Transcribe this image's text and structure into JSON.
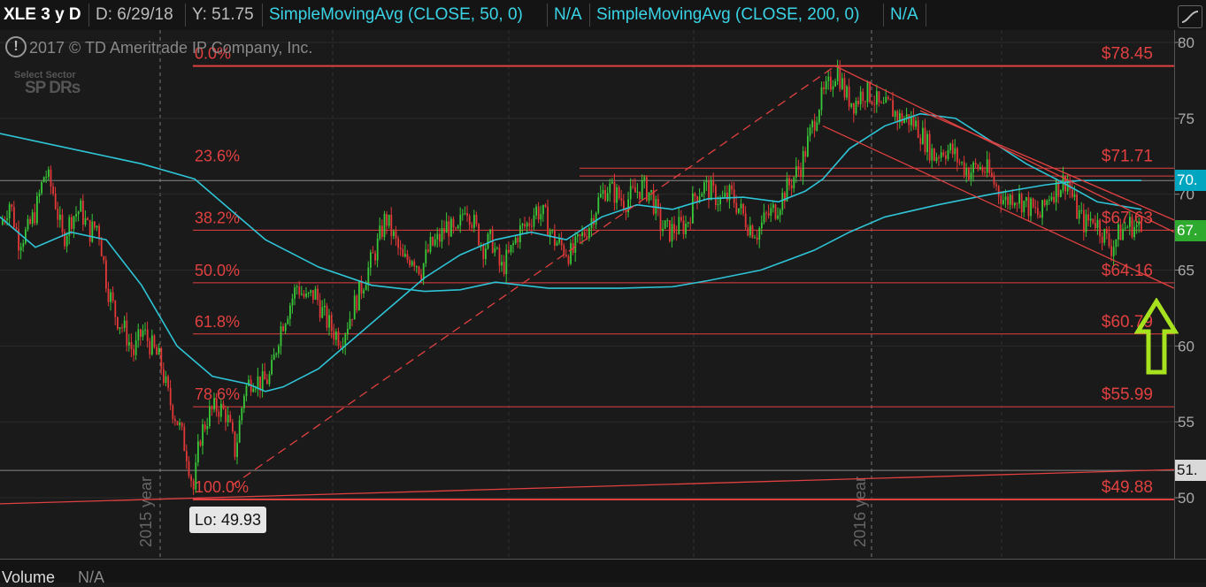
{
  "header": {
    "symbol": "XLE 3 y D",
    "date": "D: 6/29/18",
    "y_readout": "Y: 51.75",
    "sma50": "SimpleMovingAvg (CLOSE, 50, 0)",
    "sma50_value": "N/A",
    "sma200": "SimpleMovingAvg (CLOSE, 200, 0)",
    "sma200_value": "N/A"
  },
  "watermark": {
    "copyright": "2017 © TD Ameritrade IP Company, Inc.",
    "info_icon": "!",
    "logo_line1": "Select Sector",
    "logo_line2": "SP DRs"
  },
  "footer": {
    "volume_label": "Volume",
    "volume_value": "N/A"
  },
  "lo_label": "Lo: 49.93",
  "price_tags": [
    {
      "text": "70.",
      "value": 70.9,
      "bg": "#00a6c0",
      "fg": "#ffffff"
    },
    {
      "text": "67.",
      "value": 67.6,
      "bg": "#2eaa2e",
      "fg": "#ffffff"
    },
    {
      "text": "51.",
      "value": 51.8,
      "bg": "#d9d9d9",
      "fg": "#111111"
    }
  ],
  "colors": {
    "up": "#38c838",
    "down": "#e23838",
    "fib": "#e04040",
    "sma50": "#2ec4d6",
    "sma200": "#2ec4d6",
    "arrow": "#a6e21e"
  },
  "chart_data": {
    "type": "candlestick",
    "ylim": [
      45,
      81
    ],
    "yticks": [
      "80",
      "75",
      "70",
      "65",
      "60",
      "55",
      "50"
    ],
    "x_labels": [
      "2015 year",
      "2016 year"
    ],
    "fib_levels": [
      {
        "pct": "0.0%",
        "price": "$78.45",
        "value": 78.45
      },
      {
        "pct": "23.6%",
        "price": "$71.71",
        "value": 71.71
      },
      {
        "pct": "38.2%",
        "price": "$67.63",
        "value": 67.63
      },
      {
        "pct": "50.0%",
        "price": "$64.16",
        "value": 64.16
      },
      {
        "pct": "61.8%",
        "price": "$60.79",
        "value": 60.79
      },
      {
        "pct": "78.6%",
        "price": "$55.99",
        "value": 55.99
      },
      {
        "pct": "100.0%",
        "price": "$49.88",
        "value": 49.88
      }
    ],
    "gray_levels": [
      70.9,
      51.8
    ],
    "price_path": [
      [
        0,
        68
      ],
      [
        10,
        69.5
      ],
      [
        20,
        67
      ],
      [
        30,
        67.5
      ],
      [
        40,
        69
      ],
      [
        50,
        71.5
      ],
      [
        60,
        70
      ],
      [
        70,
        67
      ],
      [
        80,
        68.5
      ],
      [
        90,
        69
      ],
      [
        100,
        67.5
      ],
      [
        110,
        68
      ],
      [
        120,
        64
      ],
      [
        130,
        62
      ],
      [
        140,
        61
      ],
      [
        150,
        59.5
      ],
      [
        160,
        61
      ],
      [
        170,
        60
      ],
      [
        180,
        59
      ],
      [
        190,
        56.5
      ],
      [
        200,
        55
      ],
      [
        210,
        53
      ],
      [
        218,
        50.5
      ],
      [
        225,
        54
      ],
      [
        235,
        55.5
      ],
      [
        245,
        56
      ],
      [
        255,
        55.5
      ],
      [
        265,
        53
      ],
      [
        275,
        57
      ],
      [
        285,
        58
      ],
      [
        295,
        57.5
      ],
      [
        305,
        58
      ],
      [
        315,
        61
      ],
      [
        325,
        62.5
      ],
      [
        335,
        64
      ],
      [
        345,
        63
      ],
      [
        355,
        63.5
      ],
      [
        365,
        62
      ],
      [
        375,
        61
      ],
      [
        385,
        60.5
      ],
      [
        395,
        62
      ],
      [
        405,
        63.5
      ],
      [
        415,
        65
      ],
      [
        425,
        66.5
      ],
      [
        435,
        68.5
      ],
      [
        445,
        67
      ],
      [
        455,
        65.5
      ],
      [
        465,
        66
      ],
      [
        475,
        65
      ],
      [
        485,
        66.5
      ],
      [
        495,
        67
      ],
      [
        505,
        68
      ],
      [
        515,
        67
      ],
      [
        525,
        69.5
      ],
      [
        535,
        68
      ],
      [
        545,
        66.5
      ],
      [
        555,
        67
      ],
      [
        565,
        65
      ],
      [
        575,
        66
      ],
      [
        585,
        67.5
      ],
      [
        595,
        68
      ],
      [
        605,
        69
      ],
      [
        615,
        68.5
      ],
      [
        625,
        67
      ],
      [
        635,
        66.5
      ],
      [
        645,
        66
      ],
      [
        655,
        67
      ],
      [
        665,
        68
      ],
      [
        675,
        69.5
      ],
      [
        685,
        70.5
      ],
      [
        695,
        70
      ],
      [
        705,
        69.5
      ],
      [
        715,
        70
      ],
      [
        725,
        70.5
      ],
      [
        735,
        70
      ],
      [
        745,
        68
      ],
      [
        755,
        67.5
      ],
      [
        765,
        67.8
      ],
      [
        775,
        68
      ],
      [
        785,
        70
      ],
      [
        795,
        70.5
      ],
      [
        805,
        70
      ],
      [
        815,
        69.5
      ],
      [
        825,
        70
      ],
      [
        835,
        69
      ],
      [
        845,
        68
      ],
      [
        855,
        67.5
      ],
      [
        865,
        68.5
      ],
      [
        875,
        69
      ],
      [
        885,
        70
      ],
      [
        895,
        71
      ],
      [
        905,
        72
      ],
      [
        915,
        74
      ],
      [
        925,
        76
      ],
      [
        935,
        77
      ],
      [
        945,
        78.3
      ],
      [
        955,
        76.5
      ],
      [
        965,
        76
      ],
      [
        975,
        76.8
      ],
      [
        985,
        76.5
      ],
      [
        995,
        75.5
      ],
      [
        1005,
        75.8
      ],
      [
        1015,
        75
      ],
      [
        1025,
        75
      ],
      [
        1035,
        74.5
      ],
      [
        1045,
        73.5
      ],
      [
        1055,
        72.5
      ],
      [
        1065,
        73
      ],
      [
        1075,
        72.8
      ],
      [
        1085,
        72
      ],
      [
        1095,
        71.5
      ],
      [
        1105,
        71.8
      ],
      [
        1115,
        71.5
      ],
      [
        1125,
        70.5
      ],
      [
        1135,
        69.5
      ],
      [
        1145,
        70
      ],
      [
        1155,
        69.5
      ],
      [
        1165,
        69
      ],
      [
        1175,
        68.5
      ],
      [
        1185,
        70
      ],
      [
        1195,
        70.5
      ],
      [
        1205,
        71
      ],
      [
        1215,
        69
      ],
      [
        1225,
        68
      ],
      [
        1235,
        68.5
      ],
      [
        1245,
        67.5
      ],
      [
        1255,
        66.5
      ],
      [
        1265,
        67.5
      ],
      [
        1275,
        68
      ],
      [
        1285,
        67.8
      ],
      [
        1290,
        67.5
      ]
    ],
    "sma50_path": [
      [
        0,
        68.5
      ],
      [
        40,
        66.5
      ],
      [
        80,
        67.5
      ],
      [
        120,
        67
      ],
      [
        160,
        64
      ],
      [
        200,
        60
      ],
      [
        240,
        58
      ],
      [
        280,
        57.5
      ],
      [
        300,
        57
      ],
      [
        320,
        57.3
      ],
      [
        360,
        58.5
      ],
      [
        400,
        60.5
      ],
      [
        440,
        62.5
      ],
      [
        480,
        64.5
      ],
      [
        520,
        66
      ],
      [
        560,
        67
      ],
      [
        600,
        67.5
      ],
      [
        640,
        67
      ],
      [
        680,
        68.5
      ],
      [
        720,
        69.3
      ],
      [
        760,
        69
      ],
      [
        800,
        69.7
      ],
      [
        840,
        69.8
      ],
      [
        880,
        69.5
      ],
      [
        910,
        70.2
      ],
      [
        930,
        71
      ],
      [
        960,
        73
      ],
      [
        1000,
        74.5
      ],
      [
        1040,
        75.3
      ],
      [
        1080,
        75
      ],
      [
        1120,
        73.5
      ],
      [
        1160,
        72
      ],
      [
        1200,
        70.8
      ],
      [
        1240,
        69.5
      ],
      [
        1290,
        69
      ]
    ],
    "sma200_path": [
      [
        0,
        74
      ],
      [
        80,
        73
      ],
      [
        160,
        72
      ],
      [
        220,
        71
      ],
      [
        260,
        69
      ],
      [
        300,
        67
      ],
      [
        360,
        65.2
      ],
      [
        420,
        64
      ],
      [
        480,
        63.6
      ],
      [
        520,
        63.7
      ],
      [
        560,
        64.2
      ],
      [
        620,
        63.8
      ],
      [
        700,
        63.8
      ],
      [
        760,
        63.9
      ],
      [
        800,
        64.3
      ],
      [
        860,
        65
      ],
      [
        920,
        66.3
      ],
      [
        960,
        67.5
      ],
      [
        1000,
        68.5
      ],
      [
        1060,
        69.3
      ],
      [
        1120,
        70
      ],
      [
        1180,
        70.6
      ],
      [
        1220,
        70.9
      ],
      [
        1290,
        70.9
      ]
    ],
    "trendlines": [
      {
        "x1": 262,
        "y1": 50.8,
        "x2": 944,
        "y2": 78.45,
        "style": "dashed"
      },
      {
        "x1": 944,
        "y1": 78.45,
        "x2": 1327,
        "y2": 67.5,
        "style": "solid"
      },
      {
        "x1": 930,
        "y1": 74.5,
        "x2": 1327,
        "y2": 63.8,
        "style": "solid"
      },
      {
        "x1": 1040,
        "y1": 75.5,
        "x2": 1327,
        "y2": 68.3,
        "style": "solid"
      },
      {
        "x1": 0,
        "y1": 49.6,
        "x2": 1327,
        "y2": 51.85,
        "style": "solid"
      }
    ]
  }
}
